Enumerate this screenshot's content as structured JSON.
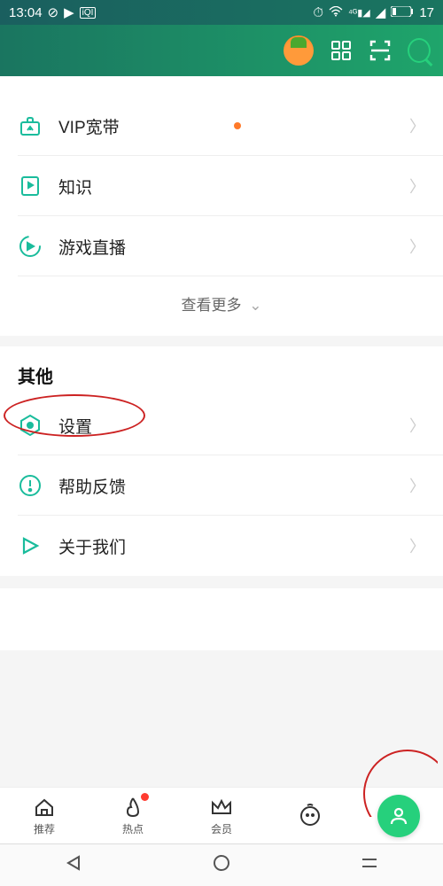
{
  "status": {
    "time": "13:04",
    "battery": "17"
  },
  "section1": {
    "items": [
      {
        "label": "VIP宽带",
        "icon": "broadband",
        "has_dot": true
      },
      {
        "label": "知识",
        "icon": "knowledge",
        "has_dot": false
      },
      {
        "label": "游戏直播",
        "icon": "gamelive",
        "has_dot": false
      }
    ],
    "view_more": "查看更多"
  },
  "section2": {
    "title": "其他",
    "items": [
      {
        "label": "设置",
        "icon": "settings"
      },
      {
        "label": "帮助反馈",
        "icon": "help"
      },
      {
        "label": "关于我们",
        "icon": "about"
      }
    ]
  },
  "nav": {
    "items": [
      {
        "label": "推荐",
        "icon": "home"
      },
      {
        "label": "热点",
        "icon": "fire",
        "dot": true
      },
      {
        "label": "会员",
        "icon": "crown"
      },
      {
        "label": "",
        "icon": "face"
      }
    ]
  }
}
